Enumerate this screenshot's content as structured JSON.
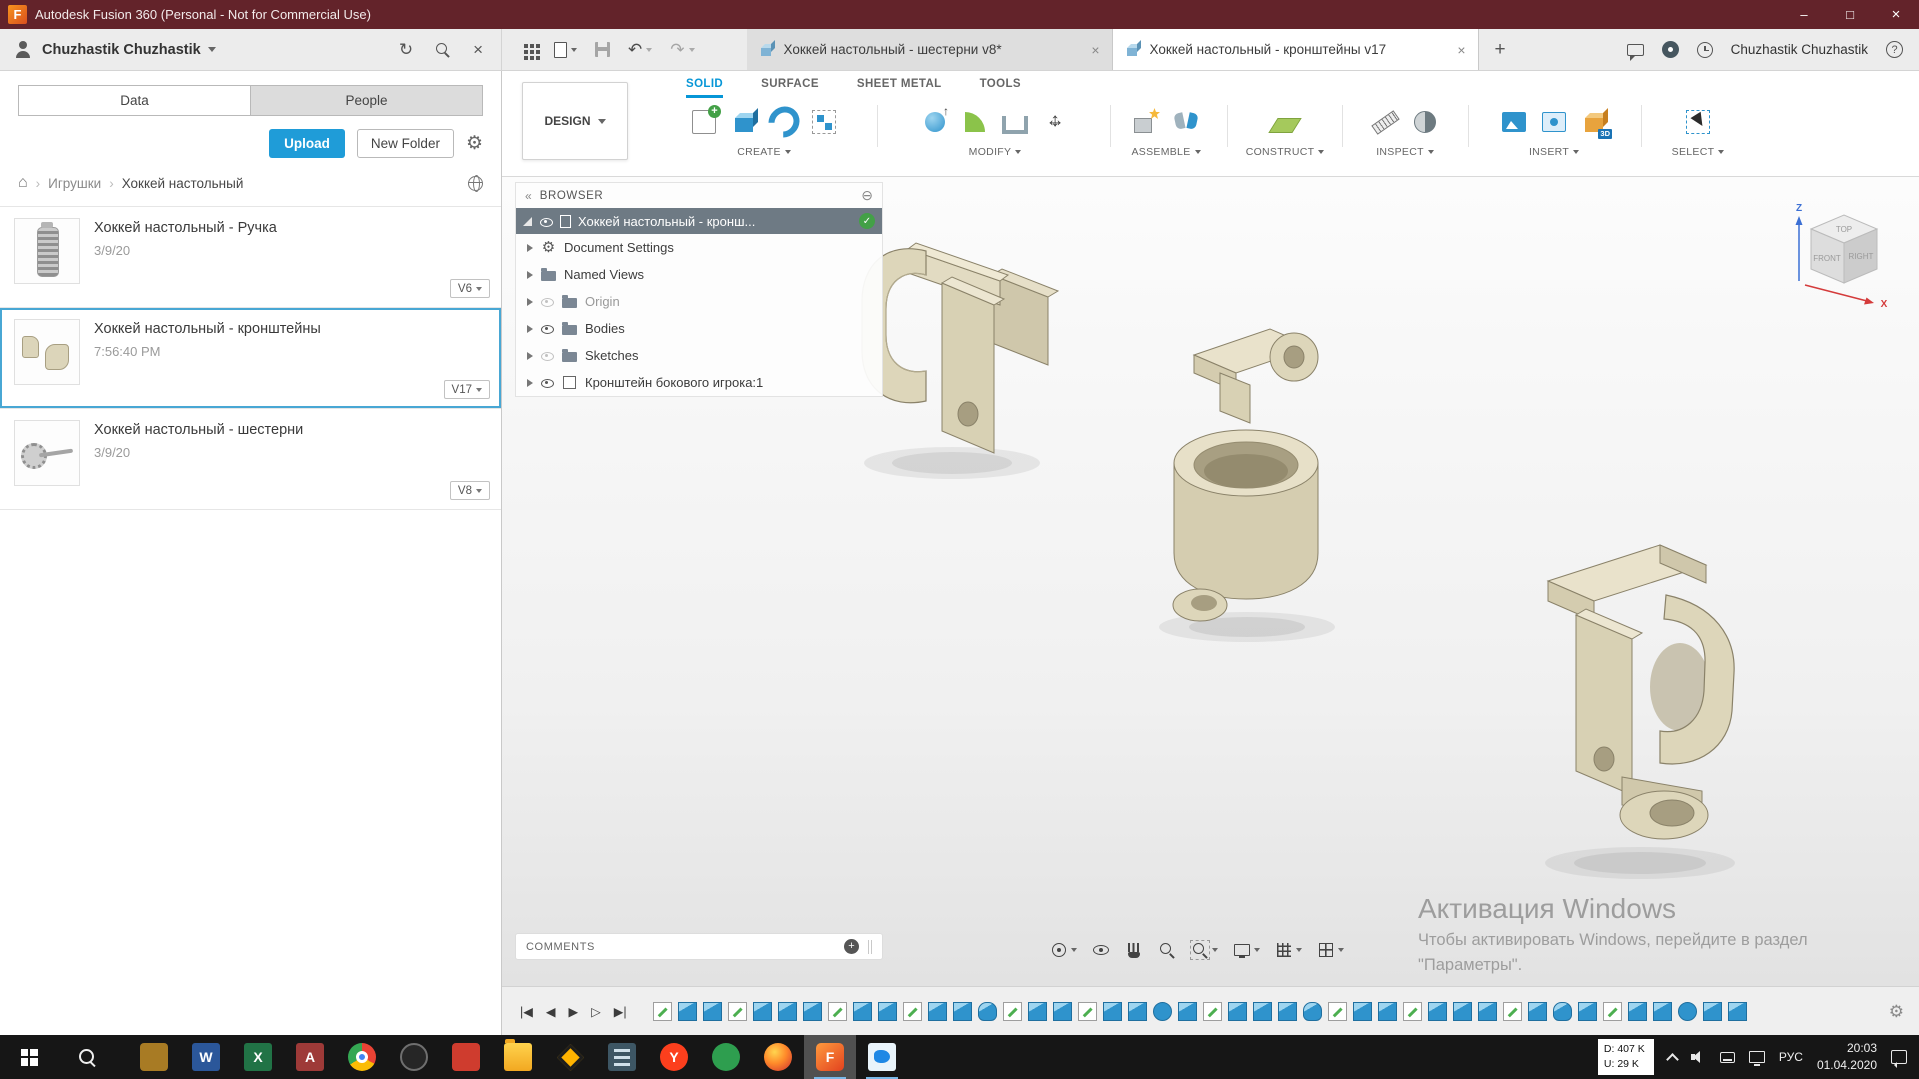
{
  "icons": {
    "undo": "↶",
    "redo": "↷",
    "refresh": "↻",
    "home": "⌂",
    "gear": "⚙",
    "check": "✓",
    "collapse": "«",
    "options": "⊖",
    "plus": "+",
    "close": "×",
    "help": "?",
    "min": "–",
    "max": "□"
  },
  "titlebar": {
    "logo": "F",
    "title": "Autodesk Fusion 360 (Personal - Not for Commercial Use)"
  },
  "appbar": {
    "user": "Chuzhastik Chuzhastik",
    "right_user": "Chuzhastik Chuzhastik",
    "tabs": [
      {
        "label": "Хоккей настольный - шестерни v8*",
        "state": "plain"
      },
      {
        "label": "Хоккей настольный - кронштейны v17",
        "state": "active"
      }
    ]
  },
  "datapanel": {
    "tab_data": "Data",
    "tab_people": "People",
    "upload": "Upload",
    "new_folder": "New Folder",
    "crumb_root": "Игрушки",
    "crumb_current": "Хоккей настольный",
    "items": [
      {
        "title": "Хоккей настольный - Ручка",
        "date": "3/9/20",
        "version": "V6",
        "thumb": "t-handle",
        "state": "plain"
      },
      {
        "title": "Хоккей настольный - кронштейны",
        "date": "7:56:40 PM",
        "version": "V17",
        "thumb": "t-brackets",
        "state": "selected"
      },
      {
        "title": "Хоккей настольный - шестерни",
        "date": "3/9/20",
        "version": "V8",
        "thumb": "t-gears",
        "state": "plain"
      }
    ]
  },
  "ribbon": {
    "design": "DESIGN",
    "tabs": [
      {
        "label": "SOLID",
        "state": "active"
      },
      {
        "label": "SURFACE",
        "state": "plain"
      },
      {
        "label": "SHEET METAL",
        "state": "plain"
      },
      {
        "label": "TOOLS",
        "state": "plain"
      }
    ],
    "groups": [
      {
        "label": "CREATE",
        "icons": [
          {
            "name": "create-sketch-icon",
            "cls": "g-sketch"
          },
          {
            "name": "extrude-icon",
            "cls": "g-extrude"
          },
          {
            "name": "revolve-icon",
            "cls": "g-revolve"
          },
          {
            "name": "pattern-icon",
            "cls": "g-pattern"
          }
        ]
      },
      {
        "label": "MODIFY",
        "icons": [
          {
            "name": "press-pull-icon",
            "cls": "g-presspull"
          },
          {
            "name": "fillet-icon",
            "cls": "g-fillet"
          },
          {
            "name": "shell-icon",
            "cls": "g-shell"
          },
          {
            "name": "move-icon",
            "cls": "g-move"
          }
        ]
      },
      {
        "label": "ASSEMBLE",
        "icons": [
          {
            "name": "new-component-icon",
            "cls": "g-newcomp"
          },
          {
            "name": "joint-icon",
            "cls": "g-joint"
          }
        ]
      },
      {
        "label": "CONSTRUCT",
        "icons": [
          {
            "name": "construct-plane-icon",
            "cls": "g-plane"
          }
        ]
      },
      {
        "label": "INSPECT",
        "icons": [
          {
            "name": "measure-icon",
            "cls": "g-measure"
          },
          {
            "name": "section-analysis-icon",
            "cls": "g-section"
          }
        ]
      },
      {
        "label": "INSERT",
        "icons": [
          {
            "name": "canvas-icon",
            "cls": "g-canvas"
          },
          {
            "name": "decal-icon",
            "cls": "g-decal"
          },
          {
            "name": "insert-mesh-icon",
            "cls": "g-mesh",
            "badge": "3D"
          }
        ]
      },
      {
        "label": "SELECT",
        "icons": [
          {
            "name": "select-icon",
            "cls": "g-select"
          }
        ]
      }
    ]
  },
  "browser": {
    "title": "BROWSER",
    "root_label": "Хоккей настольный - кронш...",
    "rows": [
      {
        "label": "Document Settings",
        "icon": "i-gear",
        "eye": "none",
        "state": "plain"
      },
      {
        "label": "Named Views",
        "icon": "i-folder",
        "eye": "none",
        "state": "plain"
      },
      {
        "label": "Origin",
        "icon": "i-folder",
        "eye": "hidden",
        "state": "dim"
      },
      {
        "label": "Bodies",
        "icon": "i-folder",
        "eye": "visible",
        "state": "plain"
      },
      {
        "label": "Sketches",
        "icon": "i-folder",
        "eye": "hidden",
        "state": "plain"
      },
      {
        "label": "Кронштейн бокового игрока:1",
        "icon": "i-component",
        "eye": "visible",
        "state": "plain"
      }
    ]
  },
  "viewport": {
    "comments_label": "COMMENTS",
    "viewcube": {
      "top": "TOP",
      "front": "FRONT",
      "right": "RIGHT",
      "z": "Z",
      "x": "X"
    },
    "watermark_title": "Активация Windows",
    "watermark_line1": "Чтобы активировать Windows, перейдите в раздел",
    "watermark_line2": "\"Параметры\"."
  },
  "timeline": {
    "controls": [
      "|◀",
      "◀",
      "▶",
      "▷",
      "▶|"
    ],
    "features": [
      "s",
      "e",
      "e",
      "s",
      "e",
      "e",
      "e",
      "s",
      "e",
      "e",
      "s",
      "e",
      "e",
      "r",
      "s",
      "e",
      "e",
      "s",
      "e",
      "e",
      "f",
      "e",
      "s",
      "e",
      "e",
      "e",
      "r",
      "s",
      "e",
      "e",
      "s",
      "e",
      "e",
      "e",
      "s",
      "e",
      "r",
      "e",
      "s",
      "e",
      "e",
      "f",
      "e",
      "e"
    ]
  },
  "taskbar": {
    "apps": [
      {
        "name": "amber-app",
        "label": "",
        "state": "plain"
      },
      {
        "name": "word",
        "label": "W",
        "state": "plain"
      },
      {
        "name": "excel",
        "label": "X",
        "state": "plain"
      },
      {
        "name": "access",
        "label": "A",
        "state": "plain"
      },
      {
        "name": "chrome",
        "label": "",
        "state": "plain"
      },
      {
        "name": "dark-circle",
        "label": "",
        "state": "plain"
      },
      {
        "name": "red-app",
        "label": "",
        "state": "plain"
      },
      {
        "name": "explorer",
        "label": "",
        "state": "plain"
      },
      {
        "name": "diamond-app",
        "label": "",
        "state": "plain"
      },
      {
        "name": "calc",
        "label": "",
        "state": "plain"
      },
      {
        "name": "yandex",
        "label": "Y",
        "state": "plain"
      },
      {
        "name": "green-circle",
        "label": "",
        "state": "plain"
      },
      {
        "name": "firefox",
        "label": "",
        "state": "plain"
      },
      {
        "name": "fusion",
        "label": "F",
        "state": "active"
      },
      {
        "name": "paint",
        "label": "",
        "state": "open"
      }
    ],
    "tray": {
      "net1": "D: 407 K",
      "net2": "U: 29 K",
      "lang": "РУС",
      "time": "20:03",
      "date": "01.04.2020"
    }
  }
}
